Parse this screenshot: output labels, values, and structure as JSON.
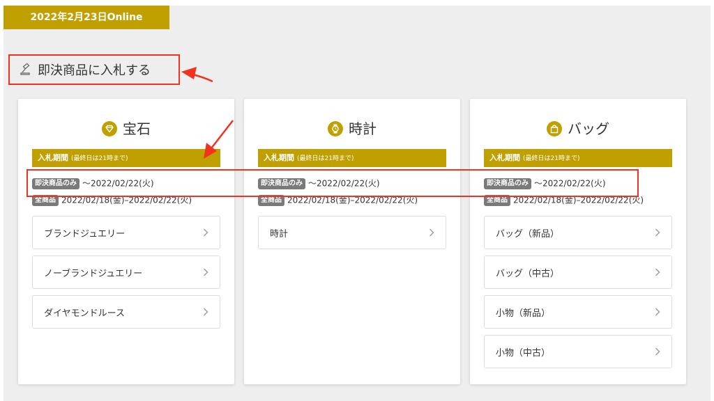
{
  "header": {
    "date_label": "2022年2月23日Online"
  },
  "section": {
    "title": "即決商品に入札する",
    "icon": "gavel-icon"
  },
  "colors": {
    "gold": "#c0a000",
    "tag_gray": "#7a7a7a",
    "annotation_red": "#f0321e",
    "background": "#eeeeee"
  },
  "cards": [
    {
      "title": "宝石",
      "icon": "gem-icon",
      "period_label": "入札期間",
      "period_note": "(最終日は21時まで)",
      "instant_tag": "即決商品のみ",
      "instant_dates": "〜2022/02/22(火)",
      "all_tag": "全商品",
      "all_dates": "2022/02/18(金)–2022/02/22(火)",
      "items": [
        "ブランドジュエリー",
        "ノーブランドジュエリー",
        "ダイヤモンドルース"
      ]
    },
    {
      "title": "時計",
      "icon": "watch-icon",
      "period_label": "入札期間",
      "period_note": "(最終日は21時まで)",
      "instant_tag": "即決商品のみ",
      "instant_dates": "〜2022/02/22(火)",
      "all_tag": "全商品",
      "all_dates": "2022/02/18(金)–2022/02/22(火)",
      "items": [
        "時計"
      ]
    },
    {
      "title": "バッグ",
      "icon": "bag-icon",
      "period_label": "入札期間",
      "period_note": "(最終日は21時まで)",
      "instant_tag": "即決商品のみ",
      "instant_dates": "〜2022/02/22(火)",
      "all_tag": "全商品",
      "all_dates": "2022/02/18(金)–2022/02/22(火)",
      "items": [
        "バッグ（新品）",
        "バッグ（中古）",
        "小物（新品）",
        "小物（中古）"
      ]
    }
  ]
}
